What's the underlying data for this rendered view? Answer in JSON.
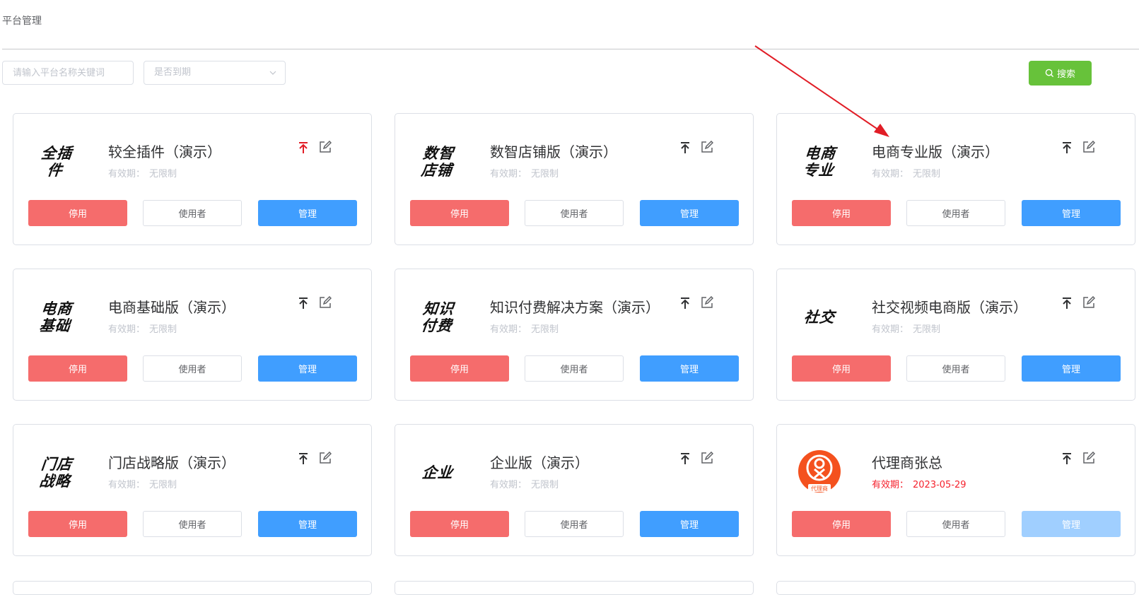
{
  "header": {
    "title": "平台管理"
  },
  "filters": {
    "keyword_placeholder": "请输入平台名称关键词",
    "expiry_select_placeholder": "是否到期",
    "search_label": "搜索"
  },
  "labels": {
    "validity": "有效期：",
    "disable": "停用",
    "users": "使用者",
    "manage": "管理"
  },
  "colors": {
    "accent_blue": "#409eff",
    "danger_red": "#f56c6c",
    "success_green": "#67c23a",
    "annotation_arrow": "#e11d26"
  },
  "cards": [
    {
      "logo": "全插件",
      "name": "较全插件（演示）",
      "validity": "无限制",
      "expired": false,
      "top_icon_active": true
    },
    {
      "logo": "数智店铺",
      "name": "数智店铺版（演示）",
      "validity": "无限制",
      "expired": false,
      "top_icon_active": false
    },
    {
      "logo": "电商专业",
      "name": "电商专业版（演示）",
      "validity": "无限制",
      "expired": false,
      "top_icon_active": false
    },
    {
      "logo": "电商基础",
      "name": "电商基础版（演示）",
      "validity": "无限制",
      "expired": false,
      "top_icon_active": false
    },
    {
      "logo": "知识付费",
      "name": "知识付费解决方案（演示）",
      "validity": "无限制",
      "expired": false,
      "top_icon_active": false
    },
    {
      "logo": "社交",
      "name": "社交视频电商版（演示）",
      "validity": "无限制",
      "expired": false,
      "top_icon_active": false
    },
    {
      "logo": "门店战略",
      "name": "门店战略版（演示）",
      "validity": "无限制",
      "expired": false,
      "top_icon_active": false
    },
    {
      "logo": "企业",
      "name": "企业版（演示）",
      "validity": "无限制",
      "expired": false,
      "top_icon_active": false
    },
    {
      "logo": "代理商",
      "logo_type": "badge",
      "name": "代理商张总",
      "validity": "2023-05-29",
      "expired": true,
      "top_icon_active": false,
      "manage_disabled": true
    }
  ]
}
